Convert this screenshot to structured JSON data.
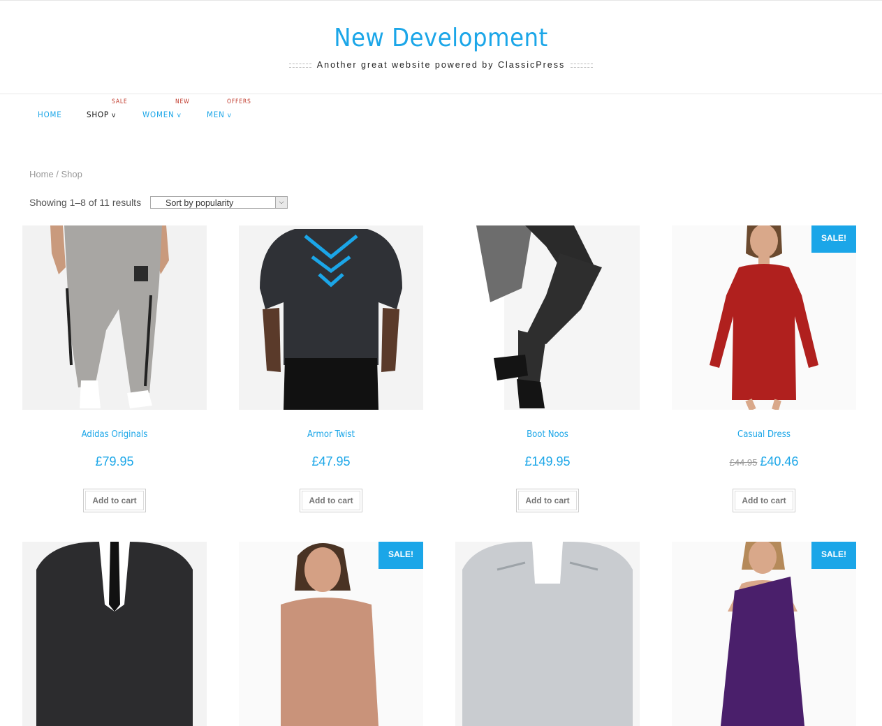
{
  "site": {
    "title": "New Development",
    "tagline": "Another great website powered by ClassicPress"
  },
  "nav": {
    "items": [
      {
        "label": "HOME",
        "badge": ""
      },
      {
        "label": "SHOP",
        "badge": "SALE"
      },
      {
        "label": "WOMEN",
        "badge": "NEW"
      },
      {
        "label": "MEN",
        "badge": "OFFERS"
      }
    ],
    "chevron": "v"
  },
  "breadcrumb": "Home / Shop",
  "results": {
    "count_text": "Showing 1–8 of 11 results",
    "sort_value": "Sort by popularity"
  },
  "products": [
    {
      "name": "Adidas Originals",
      "price": "£79.95",
      "old_price": "",
      "sale": "",
      "cart": "Add to cart"
    },
    {
      "name": "Armor Twist",
      "price": "£47.95",
      "old_price": "",
      "sale": "",
      "cart": "Add to cart"
    },
    {
      "name": "Boot Noos",
      "price": "£149.95",
      "old_price": "",
      "sale": "",
      "cart": "Add to cart"
    },
    {
      "name": "Casual Dress",
      "price": "£40.46",
      "old_price": "£44.95",
      "sale": "SALE!",
      "cart": "Add to cart"
    },
    {
      "sale": ""
    },
    {
      "sale": "SALE!"
    },
    {
      "sale": ""
    },
    {
      "sale": "SALE!"
    }
  ],
  "colors": {
    "accent": "#1ba6e8",
    "badge": "#c0392b"
  }
}
